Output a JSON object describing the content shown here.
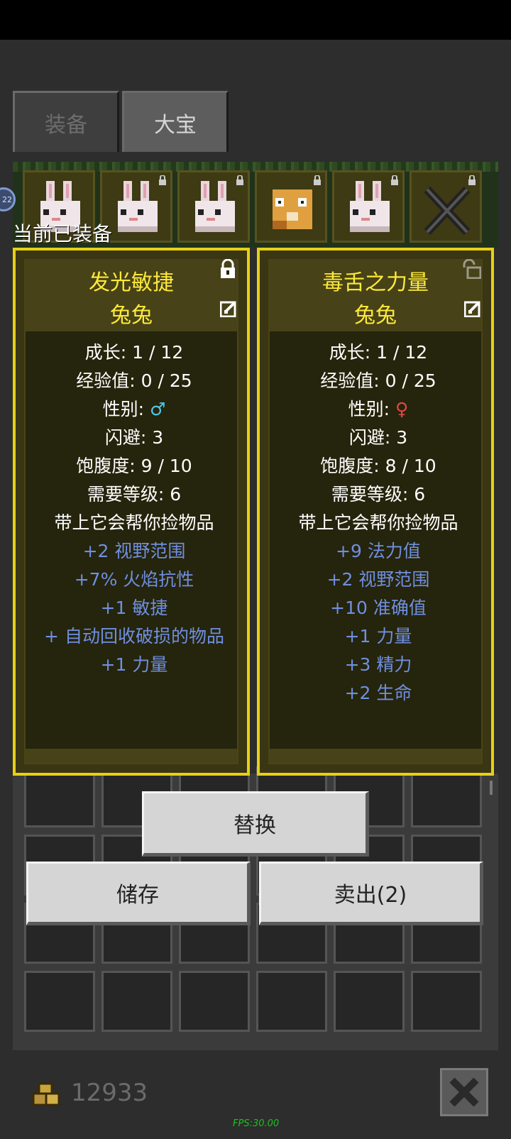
{
  "tabs": [
    {
      "label": "装备"
    },
    {
      "label": "大宝"
    }
  ],
  "badge": "22",
  "equipped_label": "当前已装备",
  "panels": [
    {
      "title": "发光敏捷",
      "subtitle": "兔兔",
      "locked": true,
      "stats": [
        {
          "text": "成长: 1 / 12"
        },
        {
          "text": "经验值: 0 / 25"
        },
        {
          "text": "性别: ",
          "gender": "♂"
        },
        {
          "text": "闪避: 3"
        },
        {
          "text": "饱腹度: 9 / 10"
        },
        {
          "text": "需要等级: 6"
        },
        {
          "text": "带上它会帮你捡物品"
        }
      ],
      "bonuses": [
        "+2 视野范围",
        "+7% 火焰抗性",
        "+1 敏捷",
        "+ 自动回收破损的物品",
        "+1 力量"
      ]
    },
    {
      "title": "毒舌之力量",
      "subtitle": "兔兔",
      "locked": false,
      "stats": [
        {
          "text": "成长: 1 / 12"
        },
        {
          "text": "经验值: 0 / 25"
        },
        {
          "text": "性别: ",
          "gender": "♀"
        },
        {
          "text": "闪避: 3"
        },
        {
          "text": "饱腹度: 8 / 10"
        },
        {
          "text": "需要等级: 6"
        },
        {
          "text": "带上它会帮你捡物品"
        }
      ],
      "bonuses": [
        "+9 法力值",
        "+2 视野范围",
        "+10 准确值",
        "+1 力量",
        "+3 精力",
        "+2 生命"
      ]
    }
  ],
  "buttons": {
    "replace": "替换",
    "store": "储存",
    "sell": "卖出(2)"
  },
  "gold": "12933",
  "fps": "FPS:30.00",
  "colors": {
    "panel_border": "#e6d116",
    "title": "#fce93b",
    "bonus": "#6f8fe0",
    "male": "#4ec8e8",
    "female": "#e04848"
  }
}
